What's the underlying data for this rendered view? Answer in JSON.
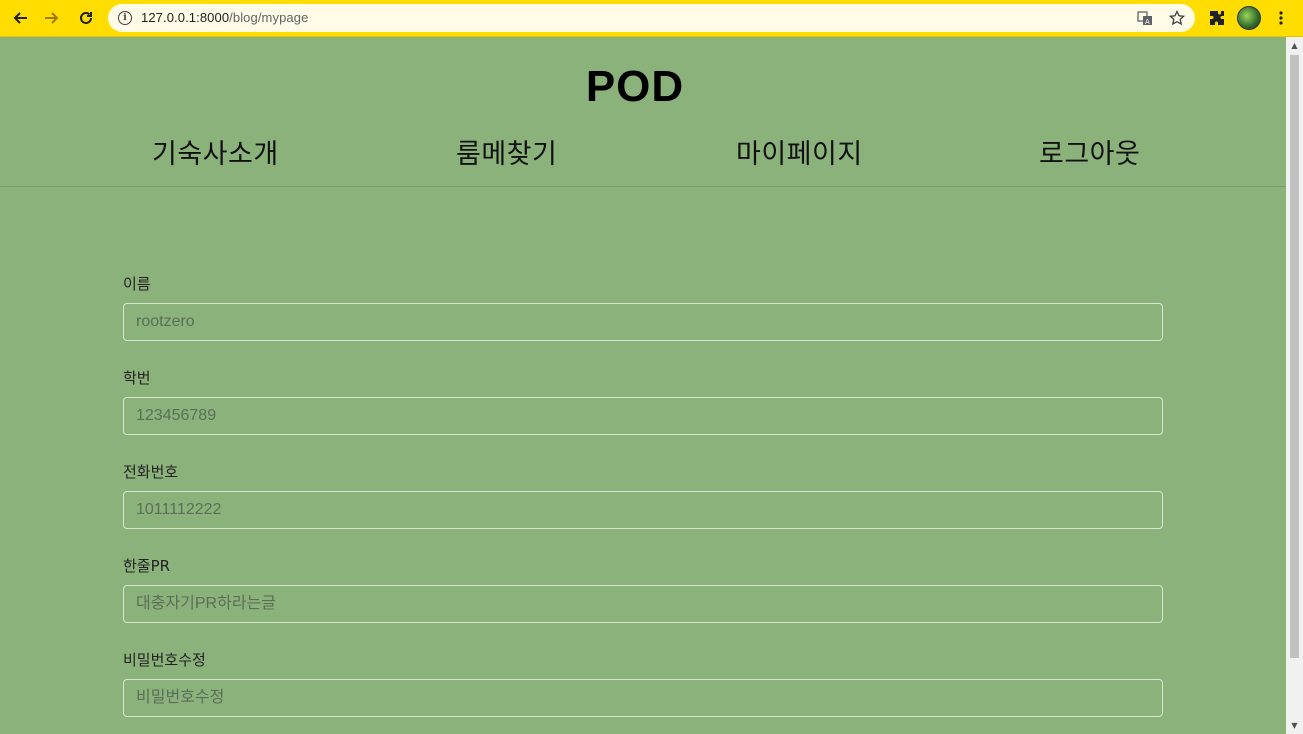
{
  "browser": {
    "url_host": "127.0.0.1:8000",
    "url_path": "/blog/mypage"
  },
  "site": {
    "title": "POD",
    "nav": [
      "기숙사소개",
      "룸메찾기",
      "마이페이지",
      "로그아웃"
    ]
  },
  "form": {
    "fields": [
      {
        "label": "이름",
        "placeholder": "rootzero"
      },
      {
        "label": "학번",
        "placeholder": "123456789"
      },
      {
        "label": "전화번호",
        "placeholder": "1011112222"
      },
      {
        "label": "한줄PR",
        "placeholder": "대충자기PR하라는글"
      },
      {
        "label": "비밀번호수정",
        "placeholder": "비밀번호수정"
      }
    ]
  }
}
